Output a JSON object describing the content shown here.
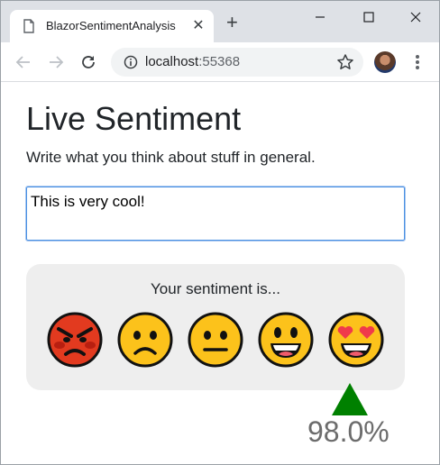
{
  "browser": {
    "tab_title": "BlazorSentimentAnalysis",
    "url_host": "localhost",
    "url_port": ":55368"
  },
  "page": {
    "heading": "Live Sentiment",
    "description": "Write what you think about stuff in general.",
    "input_value": "This is very cool!",
    "panel_label": "Your sentiment is...",
    "score_label": "98.0%",
    "score_value": 0.98,
    "emojis": [
      "angry-face",
      "frowning-face",
      "neutral-face",
      "grinning-face",
      "heart-eyes-face"
    ]
  },
  "colors": {
    "marker": "#008000",
    "panel_bg": "#eeeeee",
    "input_border": "#4a90e2"
  }
}
